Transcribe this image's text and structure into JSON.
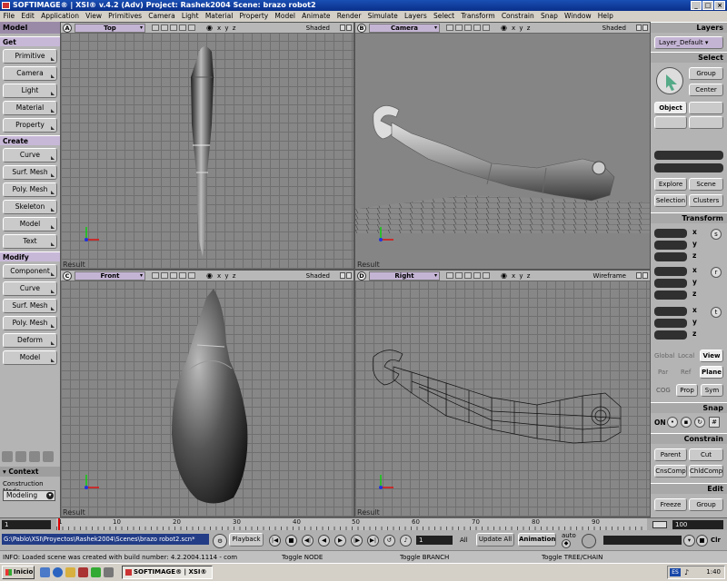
{
  "window": {
    "title": "SOFTIMAGE® | XSI® v.4.2 (Adv) Project: Rashek2004    Scene: brazo robot2"
  },
  "menubar": [
    "File",
    "Edit",
    "Application",
    "View",
    "Primitives",
    "Camera",
    "Light",
    "Material",
    "Property",
    "Model",
    "Animate",
    "Render",
    "Simulate",
    "Layers",
    "Select",
    "Transform",
    "Constrain",
    "Snap",
    "Window",
    "Help"
  ],
  "left_panel": {
    "title": "Model",
    "get": {
      "label": "Get",
      "buttons": [
        "Primitive",
        "Camera",
        "Light",
        "Material",
        "Property"
      ]
    },
    "create": {
      "label": "Create",
      "buttons": [
        "Curve",
        "Surf. Mesh",
        "Poly. Mesh",
        "Skeleton",
        "Model",
        "Text"
      ]
    },
    "modify": {
      "label": "Modify",
      "buttons": [
        "Component",
        "Curve",
        "Surf. Mesh",
        "Poly. Mesh",
        "Deform",
        "Model"
      ]
    },
    "context_label": "Context",
    "construction_mode_label": "Construction Mode",
    "construction_mode_value": "Modeling"
  },
  "viewports": [
    {
      "letter": "A",
      "camera": "Top",
      "mode": "Shaded",
      "result": "Result"
    },
    {
      "letter": "B",
      "camera": "Camera",
      "mode": "Shaded",
      "result": "Result"
    },
    {
      "letter": "C",
      "camera": "Front",
      "mode": "Shaded",
      "result": "Result"
    },
    {
      "letter": "D",
      "camera": "Right",
      "mode": "Wireframe",
      "result": "Result"
    }
  ],
  "viewport_xyz": "x y z",
  "right_panel": {
    "layers_title": "Layers",
    "layer_value": "Layer_Default",
    "select_title": "Select",
    "group": "Group",
    "center": "Center",
    "object": "Object",
    "explore": "Explore",
    "scene": "Scene",
    "selection": "Selection",
    "clusters": "Clusters",
    "transform_title": "Transform",
    "axes": [
      "x",
      "y",
      "z"
    ],
    "transform_tools": [
      "s",
      "r",
      "t"
    ],
    "global": "Global",
    "local": "Local",
    "view": "View",
    "par": "Par",
    "ref": "Ref",
    "plane": "Plane",
    "cog": "COG",
    "prop": "Prop",
    "sym": "Sym",
    "snap_title": "Snap",
    "snap_on": "ON",
    "constrain_title": "Constrain",
    "parent": "Parent",
    "cut": "Cut",
    "cnscomp": "CnsComp",
    "chldcomp": "ChldComp",
    "edit_title": "Edit",
    "freeze": "Freeze",
    "edit_group": "Group"
  },
  "timeline": {
    "start": "1",
    "end": "100",
    "ticks": [
      "1",
      "10",
      "20",
      "30",
      "40",
      "50",
      "60",
      "70",
      "80",
      "90"
    ]
  },
  "bottom_bar": {
    "path": "G:\\Pablo\\XSI\\Proyectos\\Rashek2004\\Scenes\\brazo robot2.scn*",
    "playback": "Playback",
    "frame": "1",
    "all": "All",
    "update_all": "Update All",
    "animation": "Animation",
    "auto": "auto",
    "clr": "Clr"
  },
  "status": {
    "info": "INFO: Loaded scene was created with build number: 4.2.2004.1114 - com",
    "toggle_node": "Toggle NODE",
    "toggle_branch": "Toggle BRANCH",
    "toggle_tree": "Toggle TREE/CHAIN"
  },
  "taskbar": {
    "start": "Inicio",
    "task": "SOFTIMAGE® | XSI® ...",
    "lang": "ES",
    "clock": "1:40"
  }
}
